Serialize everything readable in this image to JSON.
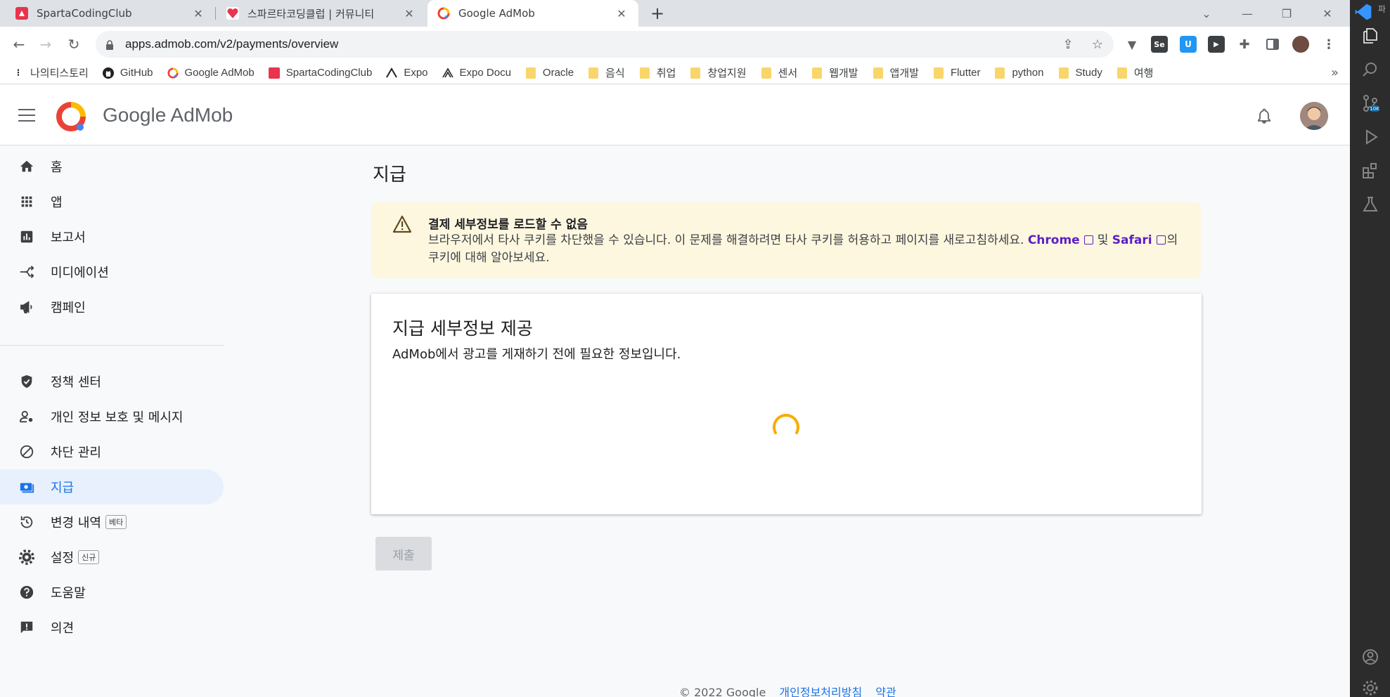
{
  "browser": {
    "tabs": [
      {
        "title": "SpartaCodingClub",
        "active": false
      },
      {
        "title": "스파르타코딩클럽 | 커뮤니티",
        "active": false
      },
      {
        "title": "Google AdMob",
        "active": true
      }
    ],
    "url": "apps.admob.com/v2/payments/overview",
    "bookmarks": [
      {
        "label": "나의티스토리",
        "icon": "tistory"
      },
      {
        "label": "GitHub",
        "icon": "github"
      },
      {
        "label": "Google AdMob",
        "icon": "admob"
      },
      {
        "label": "SpartaCodingClub",
        "icon": "sparta"
      },
      {
        "label": "Expo",
        "icon": "expo"
      },
      {
        "label": "Expo Docu",
        "icon": "expo-docs"
      },
      {
        "label": "Oracle",
        "icon": "folder"
      },
      {
        "label": "음식",
        "icon": "folder"
      },
      {
        "label": "취업",
        "icon": "folder"
      },
      {
        "label": "창업지원",
        "icon": "folder"
      },
      {
        "label": "센서",
        "icon": "folder"
      },
      {
        "label": "웹개발",
        "icon": "folder"
      },
      {
        "label": "앱개발",
        "icon": "folder"
      },
      {
        "label": "Flutter",
        "icon": "folder"
      },
      {
        "label": "python",
        "icon": "folder"
      },
      {
        "label": "Study",
        "icon": "folder"
      },
      {
        "label": "여행",
        "icon": "folder"
      }
    ],
    "more_bookmarks": "»"
  },
  "app": {
    "brand": "Google AdMob"
  },
  "nav": {
    "items": [
      {
        "label": "홈",
        "icon": "home-icon"
      },
      {
        "label": "앱",
        "icon": "apps-grid-icon"
      },
      {
        "label": "보고서",
        "icon": "bar-chart-icon"
      },
      {
        "label": "미디에이션",
        "icon": "mediation-icon"
      },
      {
        "label": "캠페인",
        "icon": "megaphone-icon"
      },
      {
        "label": "정책 센터",
        "icon": "shield-check-icon"
      },
      {
        "label": "개인 정보 보호 및 메시지",
        "icon": "person-settings-icon"
      },
      {
        "label": "차단 관리",
        "icon": "block-icon"
      },
      {
        "label": "지급",
        "icon": "payments-icon",
        "active": true
      },
      {
        "label": "변경 내역",
        "icon": "history-icon",
        "badge": "베타"
      },
      {
        "label": "설정",
        "icon": "gear-icon",
        "badge": "신규"
      },
      {
        "label": "도움말",
        "icon": "help-icon"
      },
      {
        "label": "의견",
        "icon": "feedback-icon"
      }
    ]
  },
  "main": {
    "title": "지급",
    "alert": {
      "title": "결제 세부정보를 로드할 수 없음",
      "body_part1": "브라우저에서 타사 쿠키를 차단했을 수 있습니다. 이 문제를 해결하려면 타사 쿠키를 허용하고 페이지를 새로고침하세요.",
      "link1": "Chrome",
      "conj": "및",
      "link2": "Safari",
      "body_part2": "의 쿠키에 대해 알아보세요."
    },
    "card": {
      "title": "지급 세부정보 제공",
      "subtitle": "AdMob에서 광고를 게재하기 전에 필요한 정보입니다."
    },
    "submit_label": "제출"
  },
  "footer": {
    "copyright": "© 2022 Google",
    "privacy": "개인정보처리방침",
    "terms": "약관"
  },
  "vscode": {
    "top_label": "파",
    "badge": "10K"
  },
  "colors": {
    "accent": "#1a73e8",
    "alert_bg": "#fef7e0",
    "spinner": "#f9ab00",
    "link": "#5b1fc7"
  }
}
